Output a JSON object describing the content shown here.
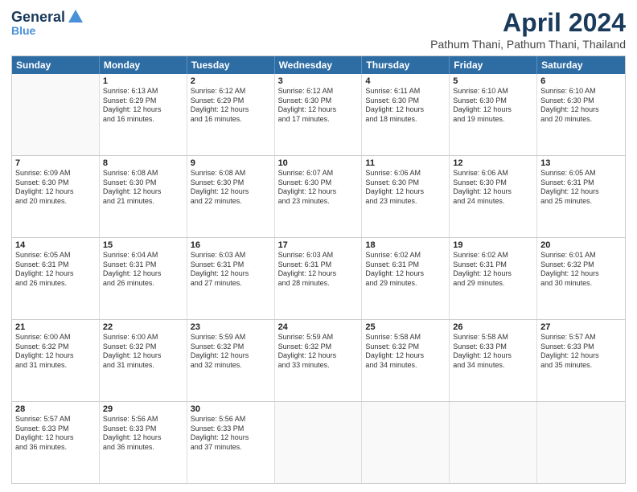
{
  "logo": {
    "line1": "General",
    "line2": "Blue"
  },
  "title": "April 2024",
  "subtitle": "Pathum Thani, Pathum Thani, Thailand",
  "days_of_week": [
    "Sunday",
    "Monday",
    "Tuesday",
    "Wednesday",
    "Thursday",
    "Friday",
    "Saturday"
  ],
  "weeks": [
    [
      {
        "day": "",
        "lines": []
      },
      {
        "day": "1",
        "lines": [
          "Sunrise: 6:13 AM",
          "Sunset: 6:29 PM",
          "Daylight: 12 hours",
          "and 16 minutes."
        ]
      },
      {
        "day": "2",
        "lines": [
          "Sunrise: 6:12 AM",
          "Sunset: 6:29 PM",
          "Daylight: 12 hours",
          "and 16 minutes."
        ]
      },
      {
        "day": "3",
        "lines": [
          "Sunrise: 6:12 AM",
          "Sunset: 6:30 PM",
          "Daylight: 12 hours",
          "and 17 minutes."
        ]
      },
      {
        "day": "4",
        "lines": [
          "Sunrise: 6:11 AM",
          "Sunset: 6:30 PM",
          "Daylight: 12 hours",
          "and 18 minutes."
        ]
      },
      {
        "day": "5",
        "lines": [
          "Sunrise: 6:10 AM",
          "Sunset: 6:30 PM",
          "Daylight: 12 hours",
          "and 19 minutes."
        ]
      },
      {
        "day": "6",
        "lines": [
          "Sunrise: 6:10 AM",
          "Sunset: 6:30 PM",
          "Daylight: 12 hours",
          "and 20 minutes."
        ]
      }
    ],
    [
      {
        "day": "7",
        "lines": [
          "Sunrise: 6:09 AM",
          "Sunset: 6:30 PM",
          "Daylight: 12 hours",
          "and 20 minutes."
        ]
      },
      {
        "day": "8",
        "lines": [
          "Sunrise: 6:08 AM",
          "Sunset: 6:30 PM",
          "Daylight: 12 hours",
          "and 21 minutes."
        ]
      },
      {
        "day": "9",
        "lines": [
          "Sunrise: 6:08 AM",
          "Sunset: 6:30 PM",
          "Daylight: 12 hours",
          "and 22 minutes."
        ]
      },
      {
        "day": "10",
        "lines": [
          "Sunrise: 6:07 AM",
          "Sunset: 6:30 PM",
          "Daylight: 12 hours",
          "and 23 minutes."
        ]
      },
      {
        "day": "11",
        "lines": [
          "Sunrise: 6:06 AM",
          "Sunset: 6:30 PM",
          "Daylight: 12 hours",
          "and 23 minutes."
        ]
      },
      {
        "day": "12",
        "lines": [
          "Sunrise: 6:06 AM",
          "Sunset: 6:30 PM",
          "Daylight: 12 hours",
          "and 24 minutes."
        ]
      },
      {
        "day": "13",
        "lines": [
          "Sunrise: 6:05 AM",
          "Sunset: 6:31 PM",
          "Daylight: 12 hours",
          "and 25 minutes."
        ]
      }
    ],
    [
      {
        "day": "14",
        "lines": [
          "Sunrise: 6:05 AM",
          "Sunset: 6:31 PM",
          "Daylight: 12 hours",
          "and 26 minutes."
        ]
      },
      {
        "day": "15",
        "lines": [
          "Sunrise: 6:04 AM",
          "Sunset: 6:31 PM",
          "Daylight: 12 hours",
          "and 26 minutes."
        ]
      },
      {
        "day": "16",
        "lines": [
          "Sunrise: 6:03 AM",
          "Sunset: 6:31 PM",
          "Daylight: 12 hours",
          "and 27 minutes."
        ]
      },
      {
        "day": "17",
        "lines": [
          "Sunrise: 6:03 AM",
          "Sunset: 6:31 PM",
          "Daylight: 12 hours",
          "and 28 minutes."
        ]
      },
      {
        "day": "18",
        "lines": [
          "Sunrise: 6:02 AM",
          "Sunset: 6:31 PM",
          "Daylight: 12 hours",
          "and 29 minutes."
        ]
      },
      {
        "day": "19",
        "lines": [
          "Sunrise: 6:02 AM",
          "Sunset: 6:31 PM",
          "Daylight: 12 hours",
          "and 29 minutes."
        ]
      },
      {
        "day": "20",
        "lines": [
          "Sunrise: 6:01 AM",
          "Sunset: 6:32 PM",
          "Daylight: 12 hours",
          "and 30 minutes."
        ]
      }
    ],
    [
      {
        "day": "21",
        "lines": [
          "Sunrise: 6:00 AM",
          "Sunset: 6:32 PM",
          "Daylight: 12 hours",
          "and 31 minutes."
        ]
      },
      {
        "day": "22",
        "lines": [
          "Sunrise: 6:00 AM",
          "Sunset: 6:32 PM",
          "Daylight: 12 hours",
          "and 31 minutes."
        ]
      },
      {
        "day": "23",
        "lines": [
          "Sunrise: 5:59 AM",
          "Sunset: 6:32 PM",
          "Daylight: 12 hours",
          "and 32 minutes."
        ]
      },
      {
        "day": "24",
        "lines": [
          "Sunrise: 5:59 AM",
          "Sunset: 6:32 PM",
          "Daylight: 12 hours",
          "and 33 minutes."
        ]
      },
      {
        "day": "25",
        "lines": [
          "Sunrise: 5:58 AM",
          "Sunset: 6:32 PM",
          "Daylight: 12 hours",
          "and 34 minutes."
        ]
      },
      {
        "day": "26",
        "lines": [
          "Sunrise: 5:58 AM",
          "Sunset: 6:33 PM",
          "Daylight: 12 hours",
          "and 34 minutes."
        ]
      },
      {
        "day": "27",
        "lines": [
          "Sunrise: 5:57 AM",
          "Sunset: 6:33 PM",
          "Daylight: 12 hours",
          "and 35 minutes."
        ]
      }
    ],
    [
      {
        "day": "28",
        "lines": [
          "Sunrise: 5:57 AM",
          "Sunset: 6:33 PM",
          "Daylight: 12 hours",
          "and 36 minutes."
        ]
      },
      {
        "day": "29",
        "lines": [
          "Sunrise: 5:56 AM",
          "Sunset: 6:33 PM",
          "Daylight: 12 hours",
          "and 36 minutes."
        ]
      },
      {
        "day": "30",
        "lines": [
          "Sunrise: 5:56 AM",
          "Sunset: 6:33 PM",
          "Daylight: 12 hours",
          "and 37 minutes."
        ]
      },
      {
        "day": "",
        "lines": []
      },
      {
        "day": "",
        "lines": []
      },
      {
        "day": "",
        "lines": []
      },
      {
        "day": "",
        "lines": []
      }
    ]
  ]
}
